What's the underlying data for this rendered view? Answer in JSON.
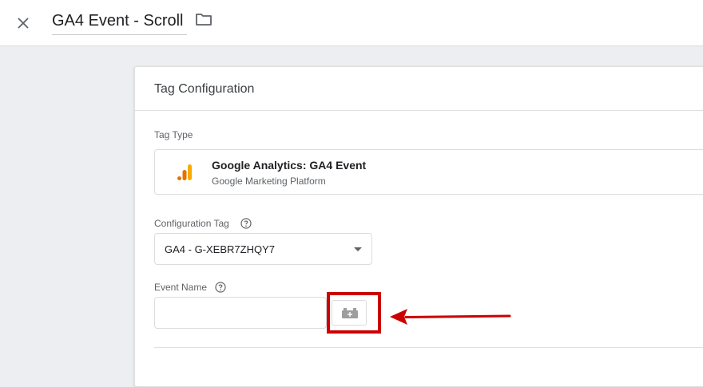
{
  "header": {
    "tag_name": "GA4 Event - Scroll",
    "close_icon": "close-icon",
    "folder_icon": "folder-icon"
  },
  "card": {
    "title": "Tag Configuration",
    "tag_type": {
      "label": "Tag Type",
      "name": "Google Analytics: GA4 Event",
      "subtitle": "Google Marketing Platform",
      "icon": "google-analytics-icon"
    },
    "configuration_tag": {
      "label": "Configuration Tag",
      "value": "GA4 - G-XEBR7ZHQY7"
    },
    "event_name": {
      "label": "Event Name",
      "value": "",
      "variable_icon": "variable-brick-icon"
    }
  },
  "colors": {
    "highlight": "#cc0000",
    "ga_orange": "#f9ab00",
    "ga_dark": "#e37400"
  }
}
